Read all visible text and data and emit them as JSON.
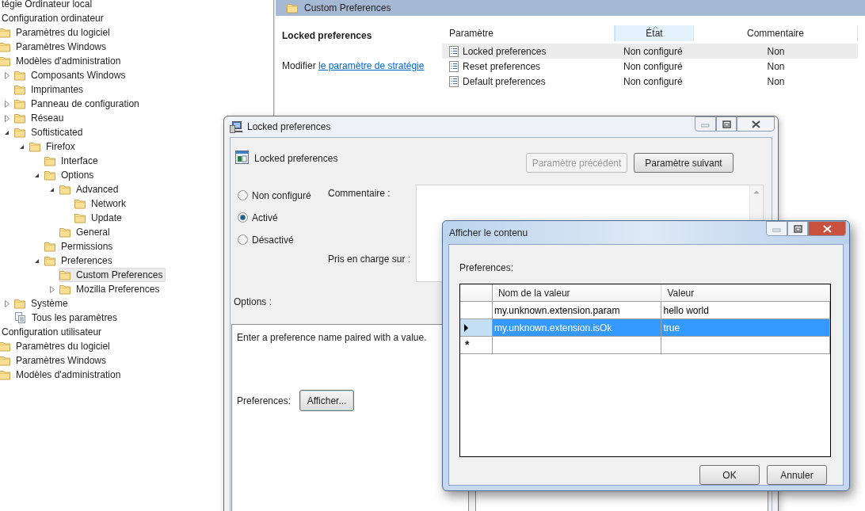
{
  "tree": [
    {
      "label": "tégie Ordinateur local",
      "kind": "node",
      "selected": false
    },
    {
      "label": "Configuration ordinateur",
      "kind": "node",
      "selected": false,
      "children": [
        {
          "label": "Paramètres du logiciel",
          "kind": "folder",
          "selected": false
        },
        {
          "label": "Paramètres Windows",
          "kind": "folder",
          "selected": false
        },
        {
          "label": "Modèles d'administration",
          "kind": "folder",
          "selected": false,
          "children": [
            {
              "label": "Composants Windows",
              "kind": "folder",
              "selected": false,
              "expanded": false
            },
            {
              "label": "Imprimantes",
              "kind": "folder",
              "selected": false
            },
            {
              "label": "Panneau de configuration",
              "kind": "folder",
              "selected": false,
              "expanded": false
            },
            {
              "label": "Réseau",
              "kind": "folder",
              "selected": false,
              "expanded": false
            },
            {
              "label": "Softisticated",
              "kind": "folder",
              "selected": false,
              "expanded": true,
              "children": [
                {
                  "label": "Firefox",
                  "kind": "folder",
                  "selected": false,
                  "expanded": true,
                  "children": [
                    {
                      "label": "Interface",
                      "kind": "folder",
                      "selected": false
                    },
                    {
                      "label": "Options",
                      "kind": "folder",
                      "selected": false,
                      "expanded": true,
                      "children": [
                        {
                          "label": "Advanced",
                          "kind": "folder",
                          "selected": false,
                          "expanded": true,
                          "children": [
                            {
                              "label": "Network",
                              "kind": "folder",
                              "selected": false
                            },
                            {
                              "label": "Update",
                              "kind": "folder",
                              "selected": false
                            }
                          ]
                        },
                        {
                          "label": "General",
                          "kind": "folder",
                          "selected": false
                        }
                      ]
                    },
                    {
                      "label": "Permissions",
                      "kind": "folder",
                      "selected": false
                    },
                    {
                      "label": "Preferences",
                      "kind": "folder",
                      "selected": false,
                      "expanded": true,
                      "children": [
                        {
                          "label": "Custom Preferences",
                          "kind": "folder",
                          "selected": true
                        },
                        {
                          "label": "Mozilla Preferences",
                          "kind": "folder",
                          "selected": false,
                          "expanded": false
                        }
                      ]
                    }
                  ]
                }
              ]
            },
            {
              "label": "Système",
              "kind": "folder",
              "selected": false,
              "expanded": false
            },
            {
              "label": "Tous les paramètres",
              "kind": "settings",
              "selected": false
            }
          ]
        }
      ]
    },
    {
      "label": "Configuration utilisateur",
      "kind": "node",
      "selected": false,
      "children": [
        {
          "label": "Paramètres du logiciel",
          "kind": "folder",
          "selected": false
        },
        {
          "label": "Paramètres Windows",
          "kind": "folder",
          "selected": false
        },
        {
          "label": "Modèles d'administration",
          "kind": "folder",
          "selected": false
        }
      ]
    }
  ],
  "header": {
    "title": "Custom Preferences"
  },
  "details": {
    "title": "Locked preferences",
    "text": "Modifier",
    "link": "le paramètre de stratégie"
  },
  "list": {
    "columns": [
      {
        "label": "Paramètre",
        "sorted": false
      },
      {
        "label": "État",
        "sorted": true
      },
      {
        "label": "Commentaire",
        "sorted": false
      }
    ],
    "rows": [
      {
        "cells": [
          "Locked preferences",
          "Non configuré",
          "Non"
        ],
        "selected": true
      },
      {
        "cells": [
          "Reset preferences",
          "Non configuré",
          "Non"
        ],
        "selected": false
      },
      {
        "cells": [
          "Default preferences",
          "Non configuré",
          "Non"
        ],
        "selected": false
      }
    ]
  },
  "policy_dialog": {
    "title": "Locked preferences",
    "heading": "Locked preferences",
    "buttons": [
      {
        "label": "Paramètre précédent",
        "disabled": true
      },
      {
        "label": "Paramètre suivant",
        "disabled": false
      }
    ],
    "states": [
      {
        "label": "Non configuré",
        "selected": false
      },
      {
        "label": "Activé",
        "selected": true
      },
      {
        "label": "Désactivé",
        "selected": false
      }
    ],
    "comment_label": "Commentaire :",
    "supported_label": "Pris en charge sur :",
    "options_label": "Options :",
    "options_text": "Enter a preference name paired with a value.",
    "preferences_label": "Preferences:",
    "show_button": "Afficher..."
  },
  "content_dialog": {
    "title": "Afficher le contenu",
    "label": "Preferences:",
    "columns": [
      "Nom de la valeur",
      "Valeur"
    ],
    "rows": [
      {
        "cells": [
          "my.unknown.extension.param",
          "hello world"
        ],
        "selected": false
      },
      {
        "cells": [
          "my.unknown.extension.isOk",
          "true"
        ],
        "selected": true
      }
    ],
    "new_row_marker": "*",
    "buttons": [
      "OK",
      "Annuler"
    ]
  }
}
